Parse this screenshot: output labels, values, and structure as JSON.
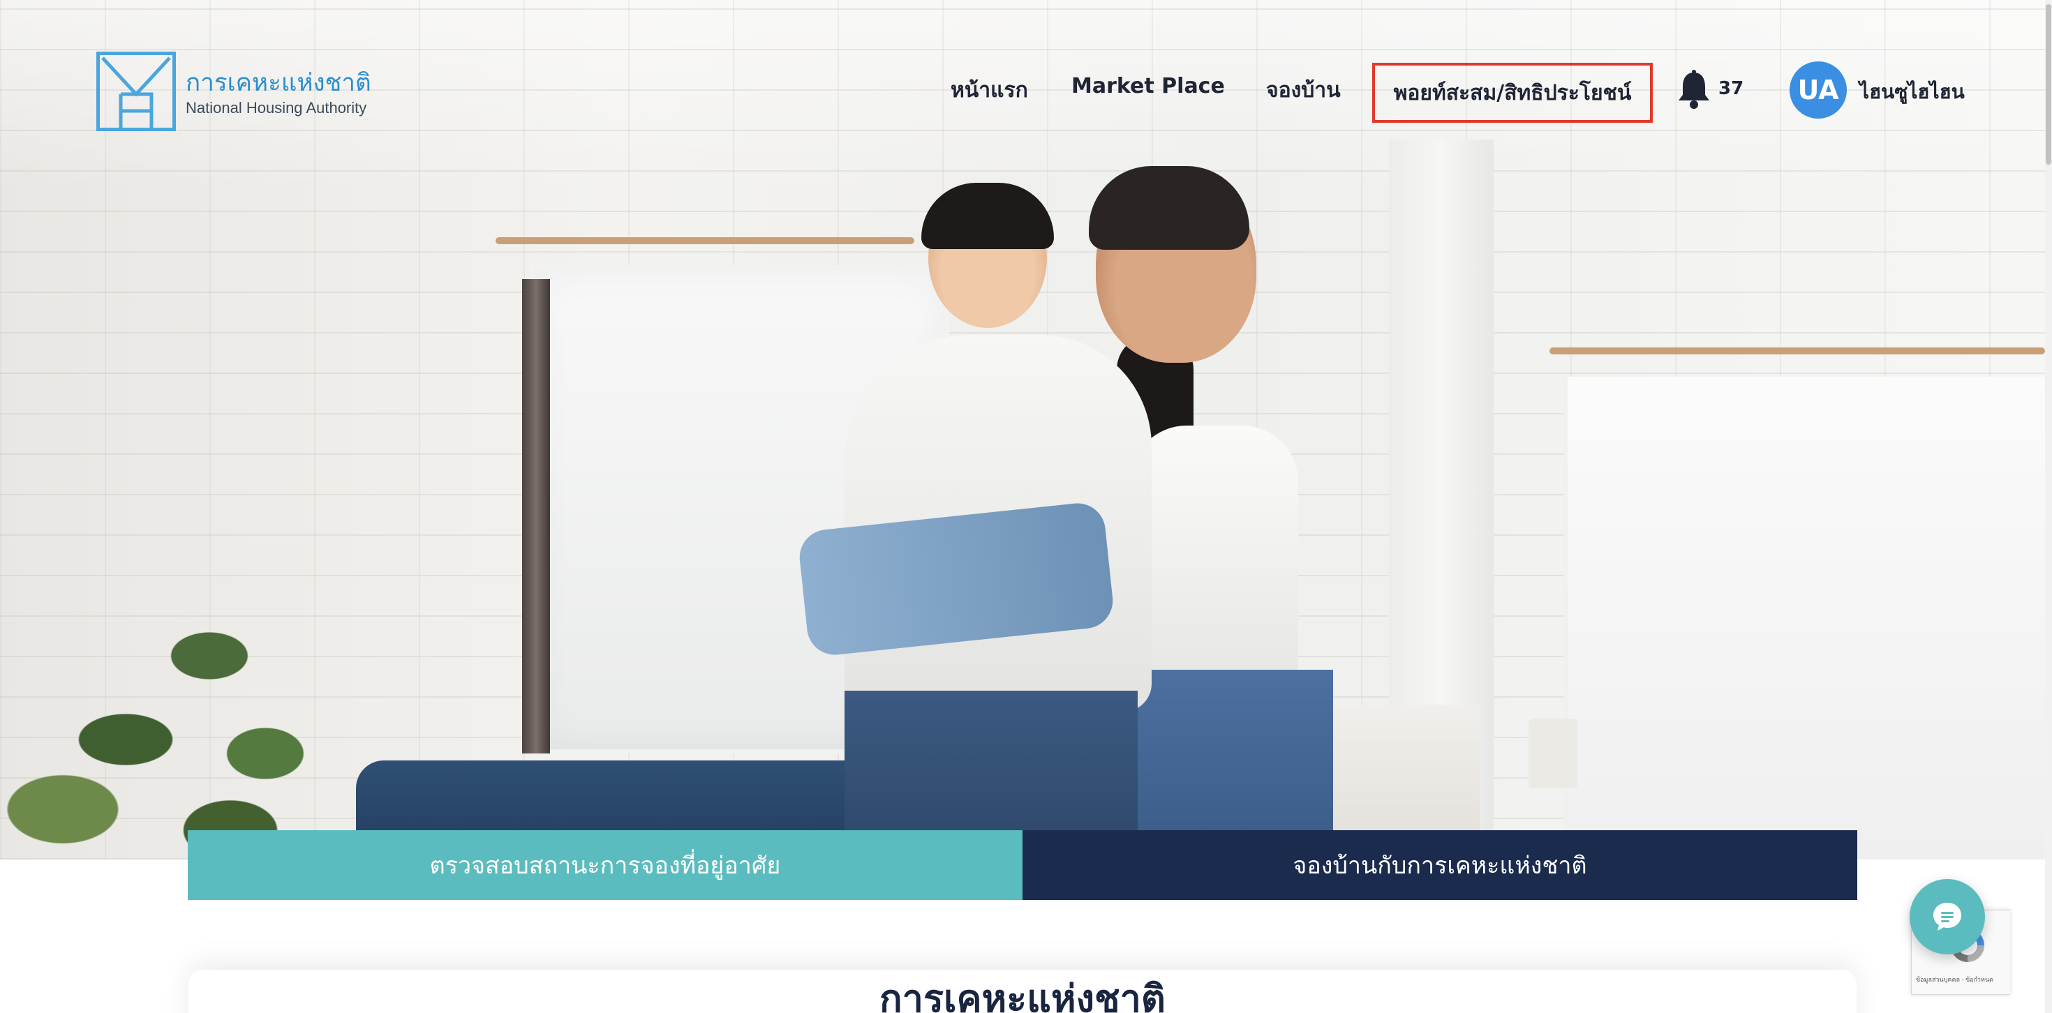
{
  "brand": {
    "name_th": "การเคหะแห่งชาติ",
    "name_en": "National Housing Authority",
    "color": "#4aa6dc"
  },
  "nav": {
    "home": "หน้าแรก",
    "market_place": "Market Place",
    "booking": "จองบ้าน",
    "points_benefits": "พอยท์สะสม/สิทธิประโยชน์",
    "notification_count": "37"
  },
  "user": {
    "initials": "UA",
    "name": "ไฮนซูไฮไฮน",
    "avatar_color": "#3b8fe3"
  },
  "actions": {
    "check_status": "ตรวจสอบสถานะการจองที่อยู่อาศัย",
    "book_house": "จองบ้านกับการเคหะแห่งชาติ",
    "check_color": "#5bbcbf",
    "book_color": "#1a2b4e"
  },
  "section": {
    "heading": "การเคหะแห่งชาติ"
  },
  "recaptcha": {
    "text": "ข้อมูลส่วนบุคคล - ข้อกำหนด"
  },
  "highlight_color": "#e0392b",
  "icons": [
    "bell-icon",
    "chat-icon",
    "recaptcha-icon",
    "logo-icon"
  ]
}
